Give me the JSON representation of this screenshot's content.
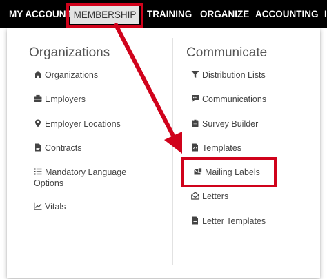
{
  "nav": {
    "my_account": "MY ACCOUNT",
    "membership": "MEMBERSHIP",
    "training": "TRAINING",
    "organize": "ORGANIZE",
    "accounting": "ACCOUNTING",
    "overflow": "I"
  },
  "organizations": {
    "title": "Organizations",
    "items": [
      {
        "label": "Organizations",
        "icon": "home-icon"
      },
      {
        "label": "Employers",
        "icon": "briefcase-icon"
      },
      {
        "label": "Employer Locations",
        "icon": "map-marker-icon"
      },
      {
        "label": "Contracts",
        "icon": "file-icon"
      },
      {
        "label": "Mandatory Language Options",
        "icon": "list-icon"
      },
      {
        "label": "Vitals",
        "icon": "line-chart-icon"
      }
    ]
  },
  "communicate": {
    "title": "Communicate",
    "items": [
      {
        "label": "Distribution Lists",
        "icon": "filter-icon"
      },
      {
        "label": "Communications",
        "icon": "comment-icon"
      },
      {
        "label": "Survey Builder",
        "icon": "clipboard-icon"
      },
      {
        "label": "Templates",
        "icon": "file-code-icon"
      },
      {
        "label": "Mailing Labels",
        "icon": "mail-labels-icon"
      },
      {
        "label": "Letters",
        "icon": "envelope-open-icon"
      },
      {
        "label": "Letter Templates",
        "icon": "file-text-icon"
      }
    ]
  },
  "colors": {
    "nav_bg": "#000000",
    "highlight": "#d0021b",
    "active_tab_bg": "#e3e3e3"
  }
}
